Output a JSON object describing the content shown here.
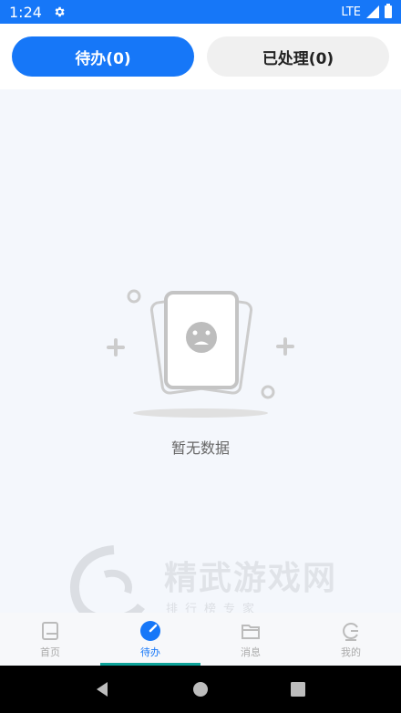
{
  "status_bar": {
    "time": "1:24",
    "network": "LTE"
  },
  "tabs_top": {
    "pending_label": "待办(0)",
    "processed_label": "已处理(0)"
  },
  "empty_state": {
    "message": "暂无数据"
  },
  "watermark": {
    "title": "精武游戏网",
    "subtitle": "排行榜专家"
  },
  "bottom_tabs": [
    {
      "label": "首页",
      "icon": "home-icon"
    },
    {
      "label": "待办",
      "icon": "todo-icon"
    },
    {
      "label": "消息",
      "icon": "message-icon"
    },
    {
      "label": "我的",
      "icon": "profile-icon"
    }
  ],
  "colors": {
    "accent": "#1677f8",
    "indicator": "#0ea39a"
  }
}
